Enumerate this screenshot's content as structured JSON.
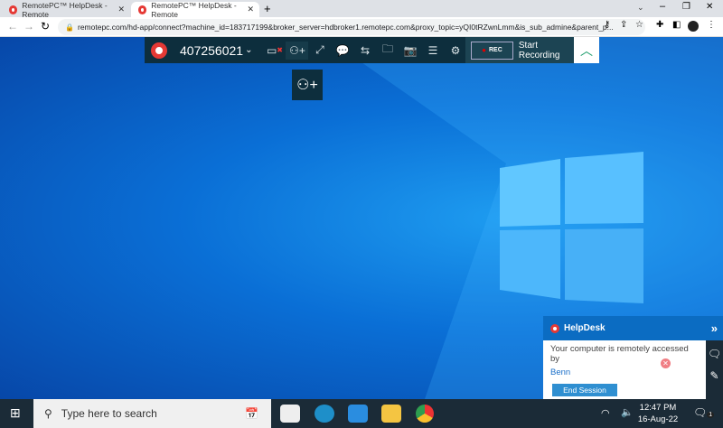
{
  "browser": {
    "tabs": [
      {
        "title": "RemotePC™ HelpDesk - Remote",
        "active": false
      },
      {
        "title": "RemotePC™ HelpDesk - Remote",
        "active": true
      }
    ],
    "url": "remotepc.com/hd-app/connect?machine_id=183717199&broker_server=hdbroker1.remotepc.com&proxy_topic=yQI0tRZwnLmm&is_sub_admine&parent_p..."
  },
  "toolbar": {
    "machine_id": "407256021",
    "rec_label": "REC",
    "start_recording": "Start Recording",
    "icons": [
      "disconnect-icon",
      "add-user-icon",
      "fullscreen-icon",
      "chat-icon",
      "transfer-icon",
      "file-browser-icon",
      "screenshot-icon",
      "notes-icon",
      "settings-icon"
    ]
  },
  "taskbar": {
    "search_placeholder": "Type here to search",
    "time": "12:47 PM",
    "date": "16-Aug-22",
    "notification_count": "1"
  },
  "helpdesk": {
    "title": "HelpDesk",
    "message": "Your computer is remotely accessed by",
    "user": "Benn",
    "end_session": "End Session"
  },
  "colors": {
    "accent": "#0b6cc2",
    "toolbar": "#0d2e3d",
    "rec": "#e00000"
  }
}
